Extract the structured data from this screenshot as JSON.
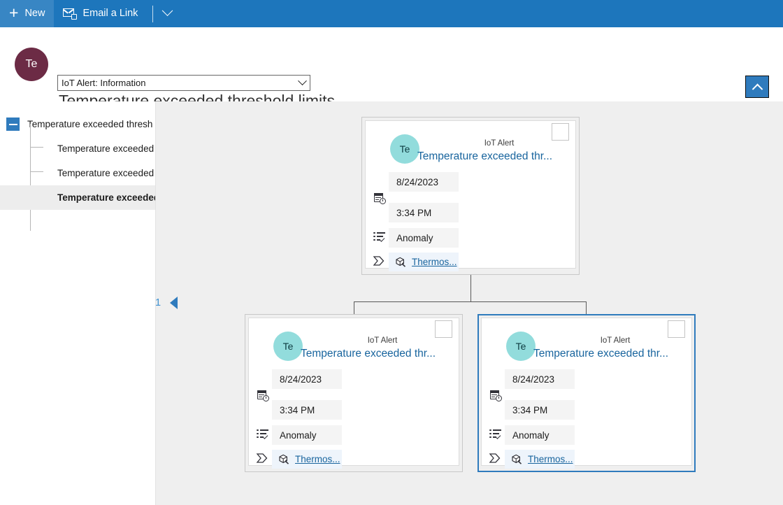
{
  "commandbar": {
    "new_label": "New",
    "email_link_label": "Email a Link",
    "new_icon": "plus-icon",
    "email_icon": "envelope-link-icon",
    "overflow_icon": "chevron-down-icon"
  },
  "header": {
    "avatar_initials": "Te",
    "record_type": "IoT Alert: Information",
    "title": "Temperature exceeded threshold limits",
    "collapse_icon": "chevron-up-icon"
  },
  "tree": {
    "expand_icon": "minus-collapse-icon",
    "items": [
      {
        "label": "Temperature exceeded thresh",
        "level": 0,
        "selected": false
      },
      {
        "label": "Temperature exceeded",
        "level": 1,
        "selected": false
      },
      {
        "label": "Temperature exceeded",
        "level": 1,
        "selected": false
      },
      {
        "label": "Temperature exceeded",
        "level": 1,
        "selected": true
      }
    ]
  },
  "paging": {
    "page_number": "1",
    "prev_icon": "triangle-left-icon"
  },
  "cards": {
    "parent": {
      "kind": "IoT Alert",
      "title": "Temperature exceeded thr...",
      "avatar_initials": "Te",
      "date": "8/24/2023",
      "time": "3:34 PM",
      "category": "Anomaly",
      "device": "Thermos...",
      "datetime_icon": "calendar-clock-icon",
      "category_icon": "list-checklist-icon",
      "device_row_icon": "flag-shape-icon",
      "device_icon": "product-box-icon",
      "checkbox_icon": "checkbox-unchecked",
      "selected": false
    },
    "child_left": {
      "kind": "IoT Alert",
      "title": "Temperature exceeded thr...",
      "avatar_initials": "Te",
      "date": "8/24/2023",
      "time": "3:34 PM",
      "category": "Anomaly",
      "device": "Thermos...",
      "datetime_icon": "calendar-clock-icon",
      "category_icon": "list-checklist-icon",
      "device_row_icon": "flag-shape-icon",
      "device_icon": "product-box-icon",
      "checkbox_icon": "checkbox-unchecked",
      "selected": false
    },
    "child_right": {
      "kind": "IoT Alert",
      "title": "Temperature exceeded thr...",
      "avatar_initials": "Te",
      "date": "8/24/2023",
      "time": "3:34 PM",
      "category": "Anomaly",
      "device": "Thermos...",
      "datetime_icon": "calendar-clock-icon",
      "category_icon": "list-checklist-icon",
      "device_row_icon": "flag-shape-icon",
      "device_icon": "product-box-icon",
      "checkbox_icon": "checkbox-unchecked",
      "selected": true
    }
  },
  "colors": {
    "command_bar": "#1d76bc",
    "header_avatar": "#6c2b45",
    "card_avatar": "#92dcdc",
    "link": "#19659e",
    "selection_border": "#2f7bbd",
    "canvas": "#efefef"
  }
}
